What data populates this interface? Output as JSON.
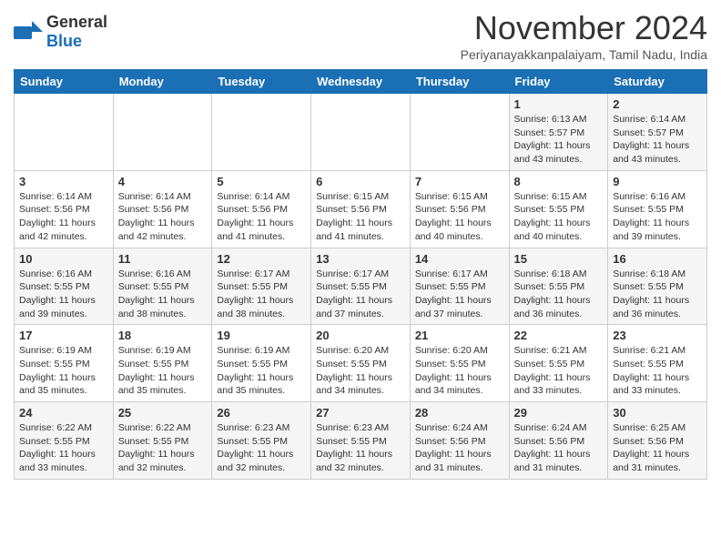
{
  "header": {
    "logo_general": "General",
    "logo_blue": "Blue",
    "month_title": "November 2024",
    "location": "Periyanayakkanpalaiyam, Tamil Nadu, India"
  },
  "days_of_week": [
    "Sunday",
    "Monday",
    "Tuesday",
    "Wednesday",
    "Thursday",
    "Friday",
    "Saturday"
  ],
  "weeks": [
    [
      {
        "day": "",
        "info": ""
      },
      {
        "day": "",
        "info": ""
      },
      {
        "day": "",
        "info": ""
      },
      {
        "day": "",
        "info": ""
      },
      {
        "day": "",
        "info": ""
      },
      {
        "day": "1",
        "info": "Sunrise: 6:13 AM\nSunset: 5:57 PM\nDaylight: 11 hours\nand 43 minutes."
      },
      {
        "day": "2",
        "info": "Sunrise: 6:14 AM\nSunset: 5:57 PM\nDaylight: 11 hours\nand 43 minutes."
      }
    ],
    [
      {
        "day": "3",
        "info": "Sunrise: 6:14 AM\nSunset: 5:56 PM\nDaylight: 11 hours\nand 42 minutes."
      },
      {
        "day": "4",
        "info": "Sunrise: 6:14 AM\nSunset: 5:56 PM\nDaylight: 11 hours\nand 42 minutes."
      },
      {
        "day": "5",
        "info": "Sunrise: 6:14 AM\nSunset: 5:56 PM\nDaylight: 11 hours\nand 41 minutes."
      },
      {
        "day": "6",
        "info": "Sunrise: 6:15 AM\nSunset: 5:56 PM\nDaylight: 11 hours\nand 41 minutes."
      },
      {
        "day": "7",
        "info": "Sunrise: 6:15 AM\nSunset: 5:56 PM\nDaylight: 11 hours\nand 40 minutes."
      },
      {
        "day": "8",
        "info": "Sunrise: 6:15 AM\nSunset: 5:55 PM\nDaylight: 11 hours\nand 40 minutes."
      },
      {
        "day": "9",
        "info": "Sunrise: 6:16 AM\nSunset: 5:55 PM\nDaylight: 11 hours\nand 39 minutes."
      }
    ],
    [
      {
        "day": "10",
        "info": "Sunrise: 6:16 AM\nSunset: 5:55 PM\nDaylight: 11 hours\nand 39 minutes."
      },
      {
        "day": "11",
        "info": "Sunrise: 6:16 AM\nSunset: 5:55 PM\nDaylight: 11 hours\nand 38 minutes."
      },
      {
        "day": "12",
        "info": "Sunrise: 6:17 AM\nSunset: 5:55 PM\nDaylight: 11 hours\nand 38 minutes."
      },
      {
        "day": "13",
        "info": "Sunrise: 6:17 AM\nSunset: 5:55 PM\nDaylight: 11 hours\nand 37 minutes."
      },
      {
        "day": "14",
        "info": "Sunrise: 6:17 AM\nSunset: 5:55 PM\nDaylight: 11 hours\nand 37 minutes."
      },
      {
        "day": "15",
        "info": "Sunrise: 6:18 AM\nSunset: 5:55 PM\nDaylight: 11 hours\nand 36 minutes."
      },
      {
        "day": "16",
        "info": "Sunrise: 6:18 AM\nSunset: 5:55 PM\nDaylight: 11 hours\nand 36 minutes."
      }
    ],
    [
      {
        "day": "17",
        "info": "Sunrise: 6:19 AM\nSunset: 5:55 PM\nDaylight: 11 hours\nand 35 minutes."
      },
      {
        "day": "18",
        "info": "Sunrise: 6:19 AM\nSunset: 5:55 PM\nDaylight: 11 hours\nand 35 minutes."
      },
      {
        "day": "19",
        "info": "Sunrise: 6:19 AM\nSunset: 5:55 PM\nDaylight: 11 hours\nand 35 minutes."
      },
      {
        "day": "20",
        "info": "Sunrise: 6:20 AM\nSunset: 5:55 PM\nDaylight: 11 hours\nand 34 minutes."
      },
      {
        "day": "21",
        "info": "Sunrise: 6:20 AM\nSunset: 5:55 PM\nDaylight: 11 hours\nand 34 minutes."
      },
      {
        "day": "22",
        "info": "Sunrise: 6:21 AM\nSunset: 5:55 PM\nDaylight: 11 hours\nand 33 minutes."
      },
      {
        "day": "23",
        "info": "Sunrise: 6:21 AM\nSunset: 5:55 PM\nDaylight: 11 hours\nand 33 minutes."
      }
    ],
    [
      {
        "day": "24",
        "info": "Sunrise: 6:22 AM\nSunset: 5:55 PM\nDaylight: 11 hours\nand 33 minutes."
      },
      {
        "day": "25",
        "info": "Sunrise: 6:22 AM\nSunset: 5:55 PM\nDaylight: 11 hours\nand 32 minutes."
      },
      {
        "day": "26",
        "info": "Sunrise: 6:23 AM\nSunset: 5:55 PM\nDaylight: 11 hours\nand 32 minutes."
      },
      {
        "day": "27",
        "info": "Sunrise: 6:23 AM\nSunset: 5:55 PM\nDaylight: 11 hours\nand 32 minutes."
      },
      {
        "day": "28",
        "info": "Sunrise: 6:24 AM\nSunset: 5:56 PM\nDaylight: 11 hours\nand 31 minutes."
      },
      {
        "day": "29",
        "info": "Sunrise: 6:24 AM\nSunset: 5:56 PM\nDaylight: 11 hours\nand 31 minutes."
      },
      {
        "day": "30",
        "info": "Sunrise: 6:25 AM\nSunset: 5:56 PM\nDaylight: 11 hours\nand 31 minutes."
      }
    ]
  ]
}
